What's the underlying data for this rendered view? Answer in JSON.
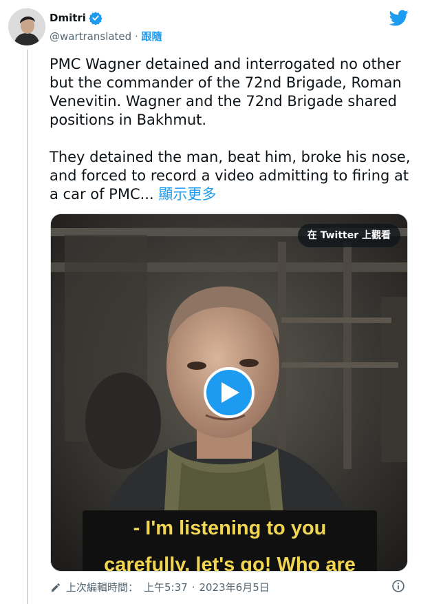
{
  "author": {
    "display_name": "Dmitri",
    "handle": "@wartranslated",
    "separator": "·",
    "follow_label": "跟隨"
  },
  "tweet": {
    "paragraph1": "PMC Wagner detained and interrogated no other but the commander of the 72nd Brigade, Roman Venevitin. Wagner and the 72nd Brigade shared positions in Bakhmut.",
    "paragraph2": "They detained the man, beat him, broke his nose, and forced to record a video admitting to firing at a car of PMC...",
    "show_more_label": "顯示更多"
  },
  "media": {
    "watch_on_twitter_label": "在 Twitter 上觀看",
    "subtitle_line1": "- I'm listening to you",
    "subtitle_line2": "carefully, let's go! Who are"
  },
  "meta": {
    "edited_label": "上次編輯時間：",
    "time": "上午5:37",
    "date": "2023年6月5日"
  },
  "colors": {
    "accent": "#1d9bf0",
    "text": "#0f1419",
    "secondary_text": "#536471",
    "subtitle": "#f2d652"
  },
  "icons": [
    "verified-badge-icon",
    "twitter-bird-icon",
    "play-icon",
    "pencil-icon",
    "info-icon"
  ]
}
